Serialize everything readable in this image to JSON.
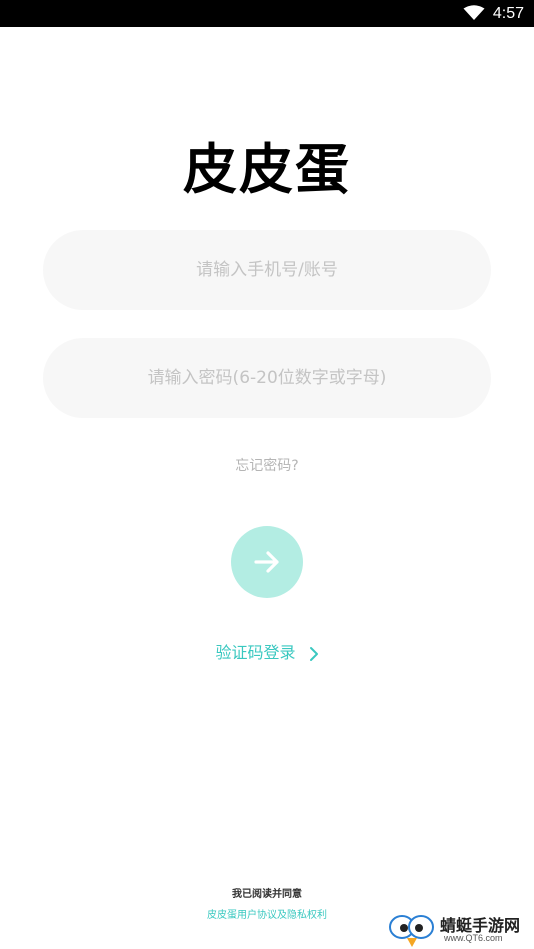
{
  "status_bar": {
    "time": "4:57",
    "wifi_icon": "wifi-icon"
  },
  "app": {
    "title": "皮皮蛋"
  },
  "form": {
    "account_placeholder": "请输入手机号/账号",
    "account_value": "",
    "password_placeholder": "请输入密码(6-20位数字或字母)",
    "password_value": "",
    "forgot_label": "忘记密码?",
    "submit_icon": "arrow-right-icon",
    "code_login_label": "验证码登录"
  },
  "agreement": {
    "prefix": "我已阅读并同意",
    "links": "皮皮蛋用户协议及隐私权利"
  },
  "watermark": {
    "title": "蜻蜓手游网",
    "url": "www.QT6.com"
  },
  "colors": {
    "accent": "#3ac8c0",
    "button_bg": "#b3ede3",
    "field_bg": "#f7f7f7",
    "placeholder": "#c4c4c4"
  }
}
